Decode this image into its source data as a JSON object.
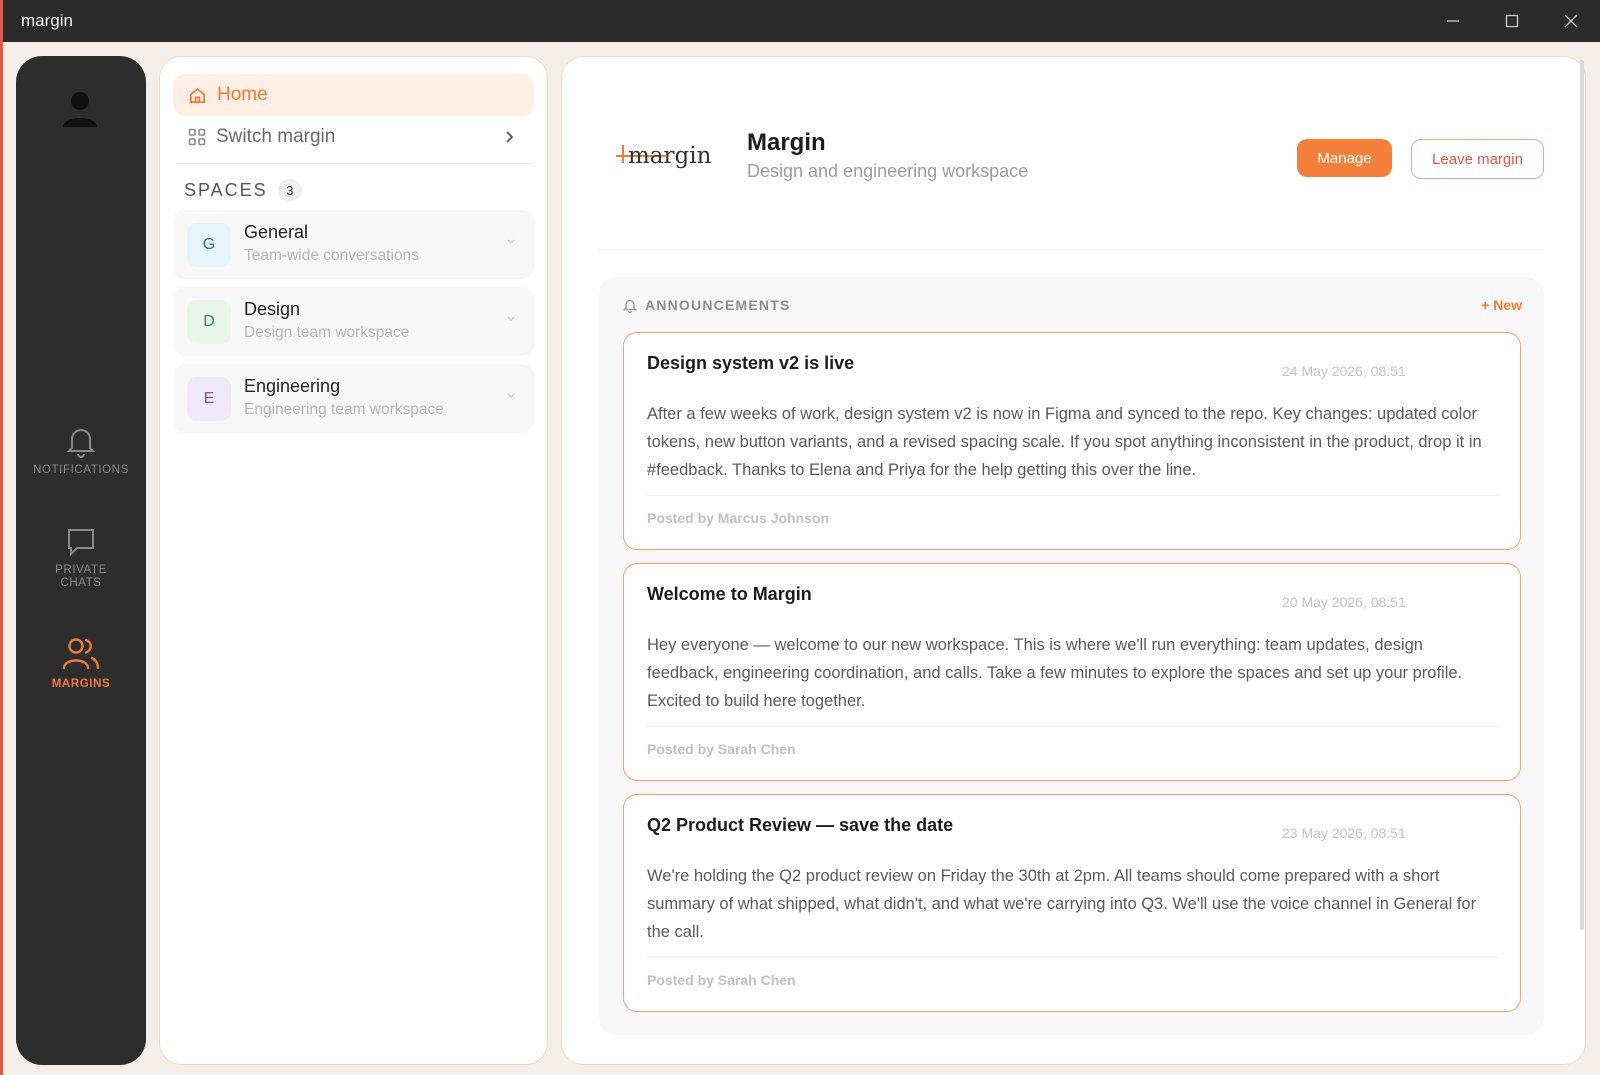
{
  "window": {
    "title": "margin"
  },
  "rail": {
    "items": [
      {
        "label": "NOTIFICATIONS",
        "icon": "bell-icon"
      },
      {
        "label": "PRIVATE CHATS",
        "icon": "chat-icon"
      },
      {
        "label": "MARGINS",
        "icon": "users-icon",
        "active": true
      }
    ]
  },
  "nav": {
    "home_label": "Home",
    "switch_label": "Switch margin"
  },
  "spaces": {
    "heading": "SPACES",
    "count": "3",
    "items": [
      {
        "letter": "G",
        "name": "General",
        "desc": "Team-wide conversations",
        "color": "#2f6f8f",
        "bg": "#e6f4fb"
      },
      {
        "letter": "D",
        "name": "Design",
        "desc": "Design team workspace",
        "color": "#3f8a4f",
        "bg": "#e7f5ea"
      },
      {
        "letter": "E",
        "name": "Engineering",
        "desc": "Engineering team workspace",
        "color": "#7a55b0",
        "bg": "#efe8f8"
      }
    ]
  },
  "workspace": {
    "logo_text": "margin",
    "name": "Margin",
    "description": "Design and engineering workspace",
    "manage_label": "Manage",
    "leave_label": "Leave margin"
  },
  "announcements": {
    "heading": "ANNOUNCEMENTS",
    "new_label": "+ New",
    "posts": [
      {
        "title": "Design system v2 is live",
        "date": "24 May 2026, 08:51",
        "body": "After a few weeks of work, design system v2 is now in Figma and synced to the repo. Key changes: updated color tokens, new button variants, and a revised spacing scale. If you spot anything inconsistent in the product, drop it in #feedback. Thanks to Elena and Priya for the help getting this over the line.",
        "author": "Posted by Marcus Johnson"
      },
      {
        "title": "Welcome to Margin",
        "date": "20 May 2026, 08:51",
        "body": "Hey everyone — welcome to our new workspace. This is where we'll run everything: team updates, design feedback, engineering coordination, and calls. Take a few minutes to explore the spaces and set up your profile. Excited to build here together.",
        "author": "Posted by Sarah Chen"
      },
      {
        "title": "Q2 Product Review — save the date",
        "date": "23 May 2026, 08:51",
        "body": "We're holding the Q2 product review on Friday the 30th at 2pm. All teams should come prepared with a short summary of what shipped, what didn't, and what we're carrying into Q3. We'll use the voice channel in General for the call.",
        "author": "Posted by Sarah Chen"
      }
    ]
  },
  "colors": {
    "accent": "#f07b35",
    "rail_bg": "#2d2d2d",
    "danger": "#d9574d"
  }
}
